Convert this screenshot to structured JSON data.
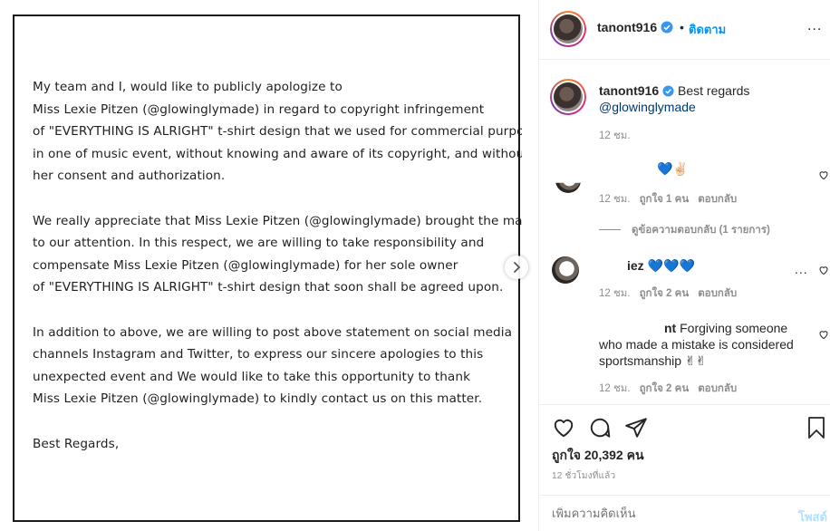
{
  "letter": {
    "lines": [
      "My team and I, would like to publicly apologize to",
      "Miss Lexie Pitzen (@glowinglymade) in regard to copyright infringement",
      "of \"EVERYTHING IS ALRIGHT\" t-shirt design that we used for commercial purposes",
      "in one of music event, without knowing and aware of its copyright, and without",
      "her consent and authorization.",
      "",
      "We really appreciate that Miss Lexie Pitzen (@glowinglymade) brought the matter",
      "to our attention. In this respect, we are willing to take responsibility and",
      "compensate Miss Lexie Pitzen (@glowinglymade) for her sole owner",
      "of \"EVERYTHING IS ALRIGHT\" t-shirt design that soon shall be agreed upon.",
      "",
      "In addition to above, we are willing to post above statement on social media",
      "channels Instagram and Twitter, to express our sincere apologies to this",
      "unexpected event and We would like to take this opportunity to thank",
      "Miss Lexie Pitzen (@glowinglymade) to kindly contact us on this matter.",
      "",
      "Best Regards,"
    ]
  },
  "header": {
    "username": "tanont916",
    "separator": "•",
    "follow_label": "ติดตาม",
    "more": "..."
  },
  "caption": {
    "username": "tanont916",
    "text": "Best regards",
    "mention": "@glowinglymade",
    "time": "12 ชม."
  },
  "comments": [
    {
      "user": "",
      "text": "💙✌🏻",
      "time": "12 ชม.",
      "likes": "ถูกใจ 1 คน",
      "reply": "ตอบกลับ",
      "view_replies": "ดูข้อความตอบกลับ (1 รายการ)"
    },
    {
      "user": "iez",
      "text": "💙💙💙",
      "time": "12 ชม.",
      "likes": "ถูกใจ 2 คน",
      "reply": "ตอบกลับ",
      "more": "..."
    },
    {
      "user": "nt",
      "text": "Forgiving someone",
      "text2": "who made a mistake is considered",
      "text3": "sportsmanship ✌✌",
      "time": "12 ชม.",
      "likes": "ถูกใจ 2 คน",
      "reply": "ตอบกลับ"
    }
  ],
  "actions": {
    "likes": "ถูกใจ 20,392 คน",
    "time": "12 ชั่วโมงที่แล้ว"
  },
  "add_comment": {
    "placeholder": "เพิ่มความคิดเห็น",
    "post_label": "โพสต์"
  },
  "colors": {
    "link": "#0095f6",
    "muted": "#8e8e8e",
    "text": "#262626"
  }
}
